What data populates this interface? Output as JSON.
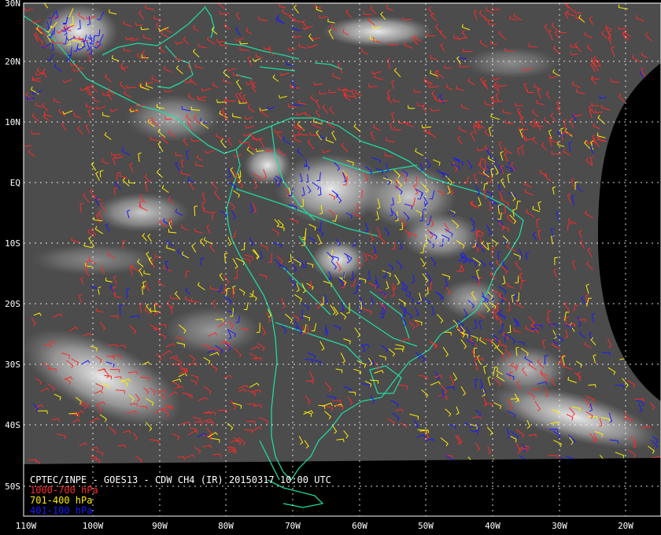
{
  "title": "CPTEC/INPE - GOES13 - CDW CH4 (IR) 20150317 10:00 UTC",
  "legend": [
    {
      "label": "1000-700 hPa",
      "color": "#ff2a2a"
    },
    {
      "label": "701-400 hPa",
      "color": "#ffee00"
    },
    {
      "label": "401-100 hPa",
      "color": "#1a1aff"
    }
  ],
  "lat_labels": [
    "30N",
    "20N",
    "10N",
    "EQ",
    "10S",
    "20S",
    "30S",
    "40S",
    "50S"
  ],
  "lon_labels": [
    "110W",
    "100W",
    "90W",
    "80W",
    "70W",
    "60W",
    "50W",
    "40W",
    "30W",
    "20W"
  ],
  "colors": {
    "coastline": "#20d8a0",
    "grid": "#ffffff",
    "background": "#000000",
    "cloud": "#e6e6e6",
    "sea": "#555555"
  }
}
